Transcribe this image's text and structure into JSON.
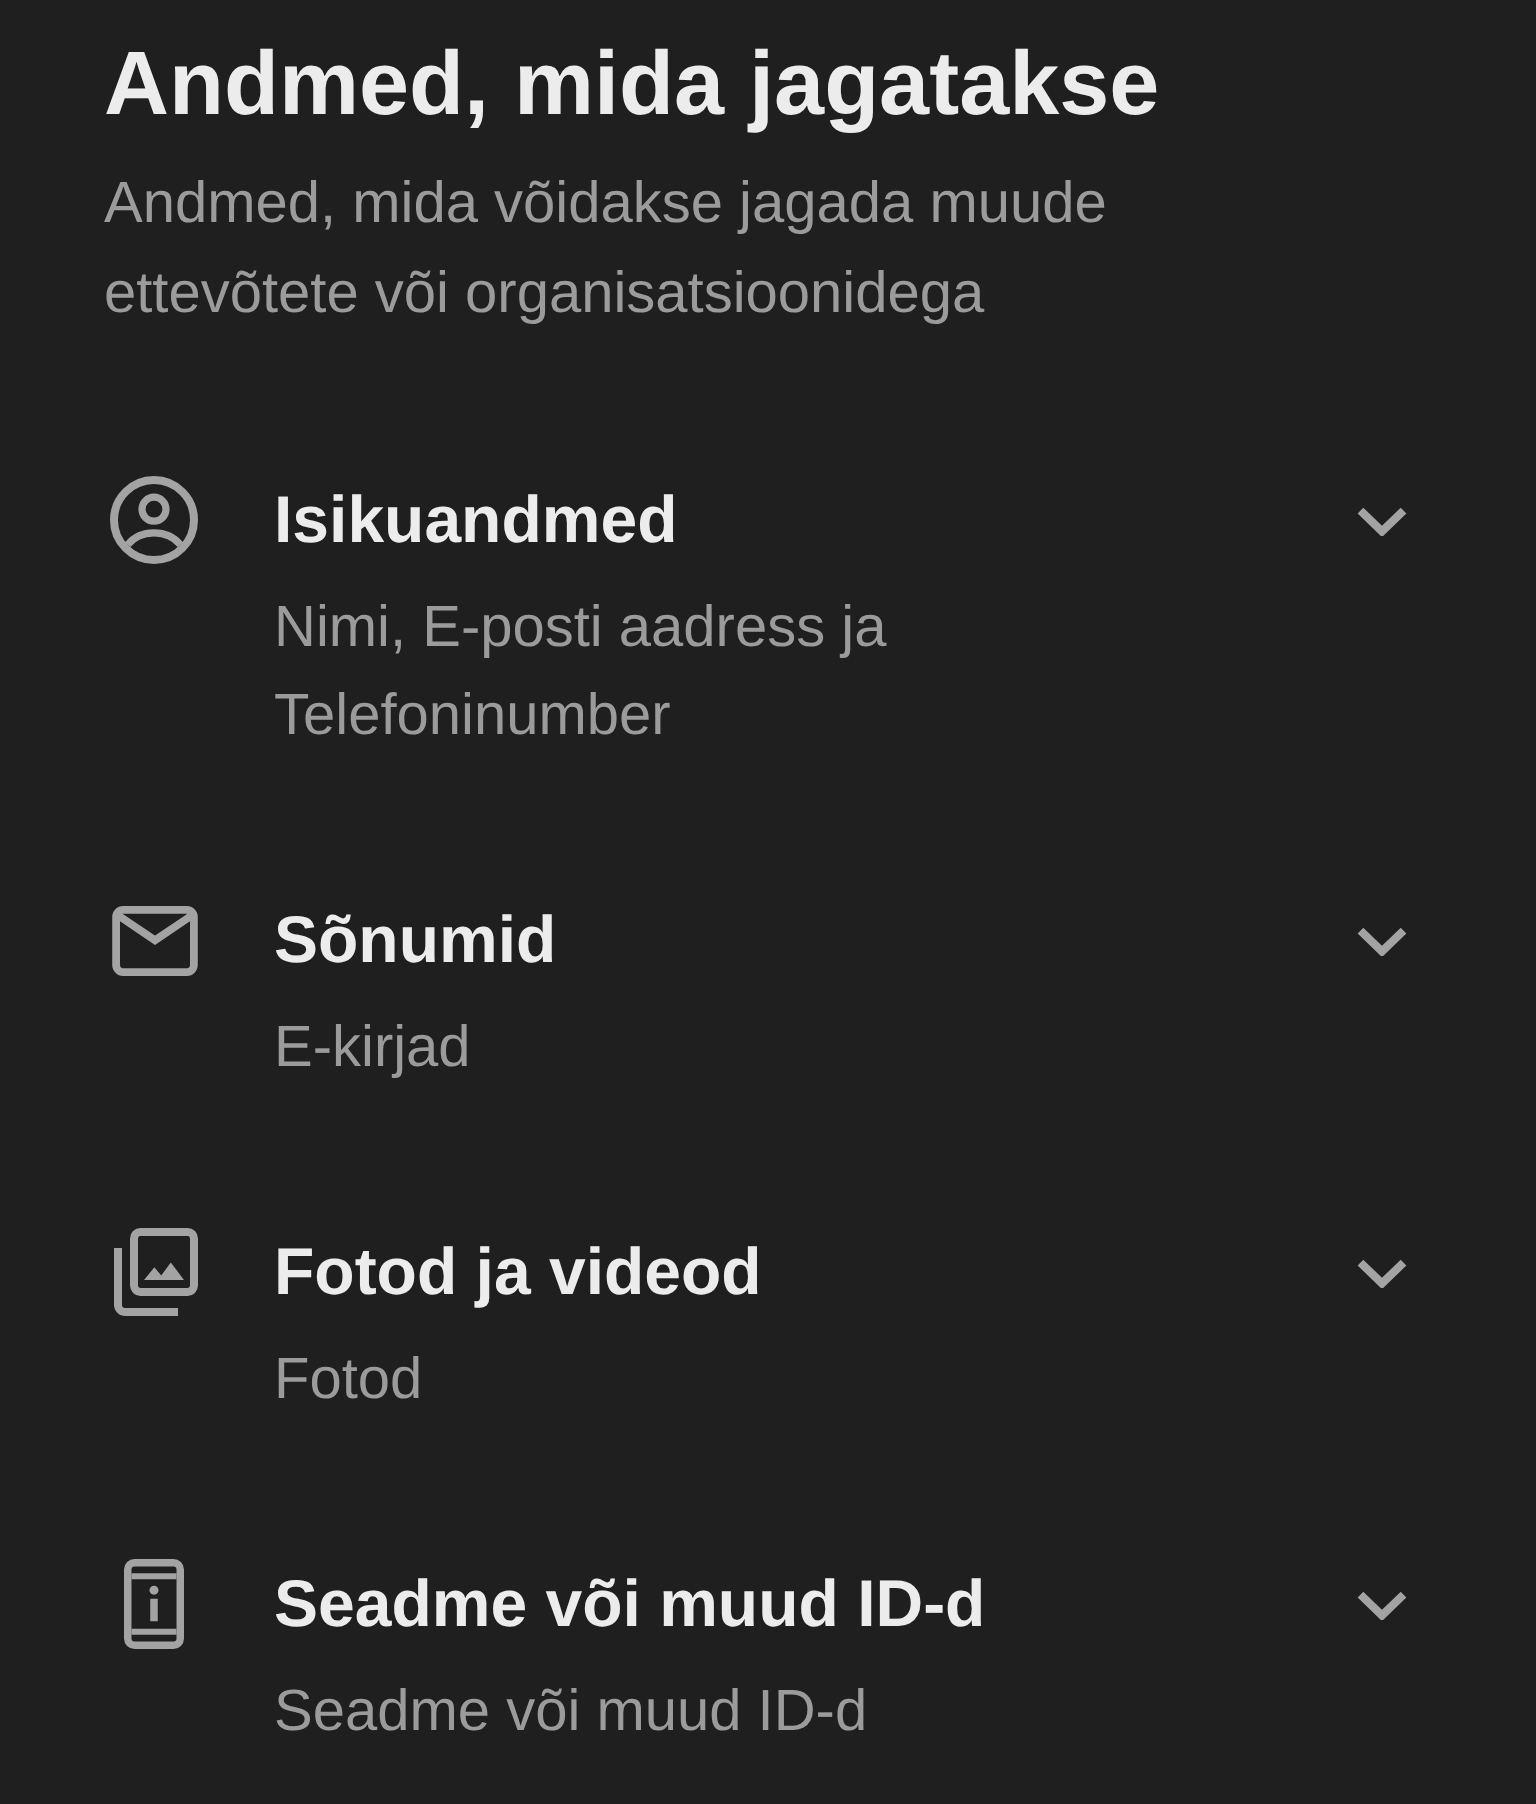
{
  "header": {
    "title": "Andmed, mida jagatakse",
    "subtitle": "Andmed, mida võidakse jagada muude ettevõtete või organisatsioonidega"
  },
  "categories": [
    {
      "kind": "person",
      "title": "Isikuandmed",
      "detail": "Nimi, E-posti aadress ja Telefoninumber",
      "expanded": false
    },
    {
      "kind": "mail",
      "title": "Sõnumid",
      "detail": "E-kirjad",
      "expanded": false
    },
    {
      "kind": "photos",
      "title": "Fotod ja videod",
      "detail": "Fotod",
      "expanded": false
    },
    {
      "kind": "device",
      "title": "Seadme või muud ID-d",
      "detail": "Seadme või muud ID-d",
      "expanded": false
    }
  ]
}
